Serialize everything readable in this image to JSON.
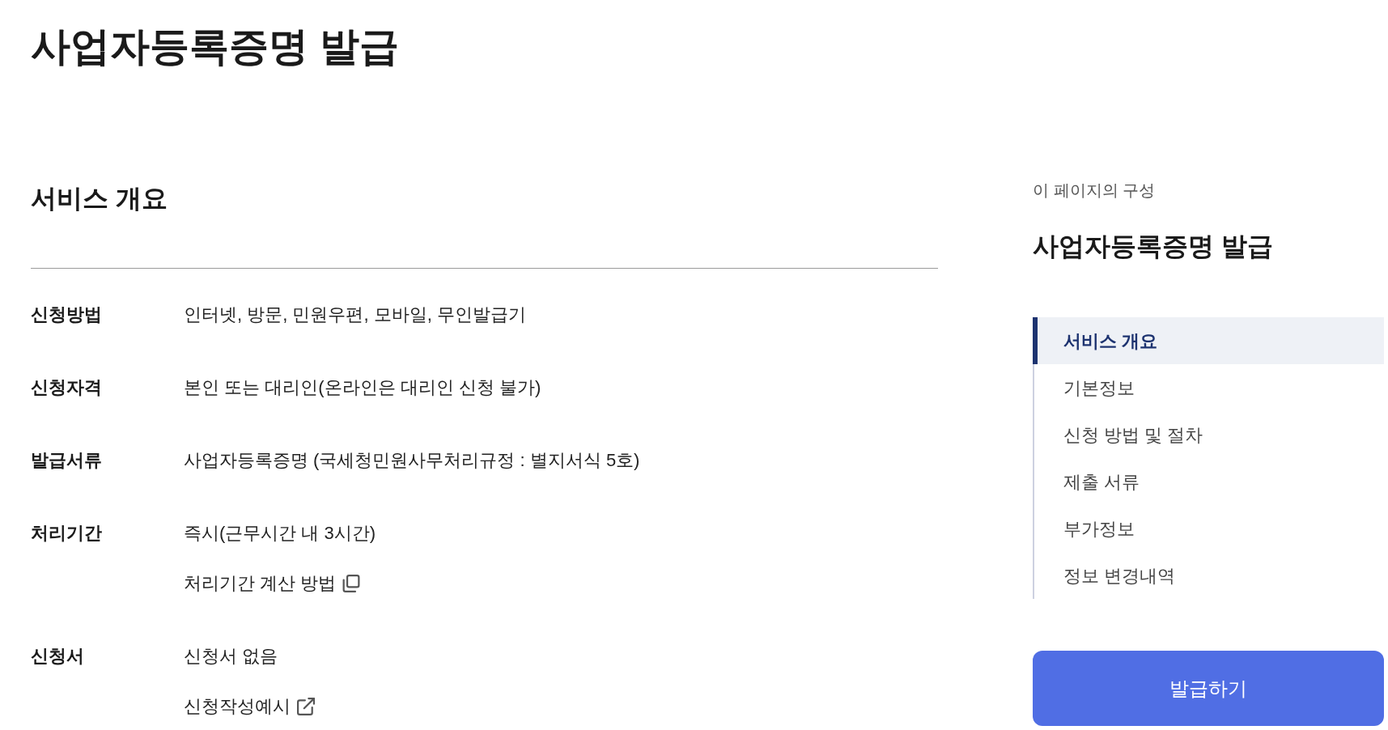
{
  "page_title": "사업자등록증명 발급",
  "overview": {
    "title": "서비스 개요",
    "rows": [
      {
        "label": "신청방법",
        "lines": [
          {
            "kind": "text",
            "text": "인터넷, 방문, 민원우편, 모바일, 무인발급기"
          }
        ]
      },
      {
        "label": "신청자격",
        "lines": [
          {
            "kind": "text",
            "text": "본인 또는 대리인(온라인은 대리인 신청 불가)"
          }
        ]
      },
      {
        "label": "발급서류",
        "lines": [
          {
            "kind": "text",
            "text": "사업자등록증명 (국세청민원사무처리규정 : 별지서식 5호)"
          }
        ]
      },
      {
        "label": "처리기간",
        "lines": [
          {
            "kind": "text",
            "text": "즉시(근무시간 내 3시간)"
          },
          {
            "kind": "popup",
            "text": "처리기간 계산 방법"
          }
        ]
      },
      {
        "label": "신청서",
        "lines": [
          {
            "kind": "text",
            "text": "신청서 없음"
          },
          {
            "kind": "external",
            "text": "신청작성예시"
          }
        ]
      }
    ]
  },
  "toc": {
    "caption": "이 페이지의 구성",
    "title": "사업자등록증명 발급",
    "items": [
      {
        "label": "서비스 개요",
        "selected": true
      },
      {
        "label": "기본정보",
        "selected": false
      },
      {
        "label": "신청 방법 및 절차",
        "selected": false
      },
      {
        "label": "제출 서류",
        "selected": false
      },
      {
        "label": "부가정보",
        "selected": false
      },
      {
        "label": "정보 변경내역",
        "selected": false
      }
    ]
  },
  "issue_button": {
    "label": "발급하기"
  }
}
